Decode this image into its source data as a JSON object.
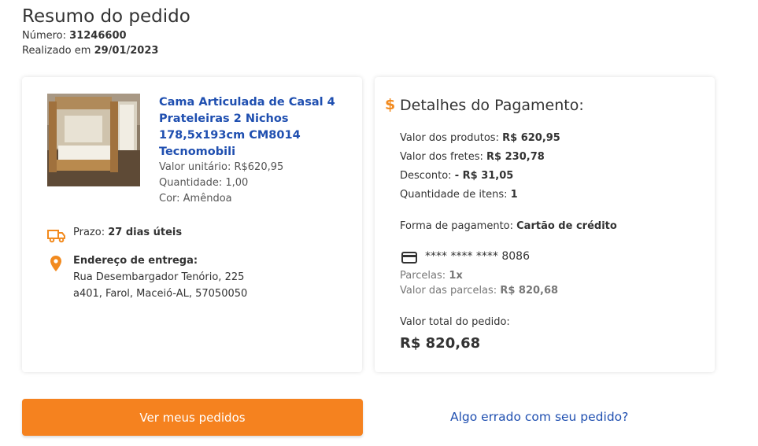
{
  "header": {
    "title": "Resumo do pedido",
    "number_label": "Número:",
    "number_value": "31246600",
    "date_label": "Realizado em",
    "date_value": "29/01/2023"
  },
  "product": {
    "name": "Cama Articulada de Casal 4 Prateleiras 2 Nichos 178,5x193cm CM8014 Tecnomobili",
    "unit_price": "Valor unitário: R$620,95",
    "quantity": "Quantidade: 1,00",
    "color": "Cor: Amêndoa",
    "image_alt": "bed-photo"
  },
  "delivery": {
    "deadline_label": "Prazo:",
    "deadline_value": "27 dias úteis",
    "address_label": "Endereço de entrega:",
    "address_line1": "Rua Desembargador Tenório, 225",
    "address_line2": "a401, Farol, Maceió-AL, 57050050"
  },
  "payment": {
    "title": "Detalhes do Pagamento:",
    "products_label": "Valor dos produtos:",
    "products_value": "R$ 620,95",
    "shipping_label": "Valor dos fretes:",
    "shipping_value": "R$ 230,78",
    "discount_label": "Desconto:",
    "discount_value": "- R$ 31,05",
    "items_label": "Quantidade de itens:",
    "items_value": "1",
    "method_label": "Forma de pagamento:",
    "method_value": "Cartão de crédito",
    "card_number": "**** **** **** 8086",
    "installments_label": "Parcelas:",
    "installments_value": "1x",
    "installment_value_label": "Valor das parcelas:",
    "installment_value": "R$ 820,68",
    "total_label": "Valor total do pedido:",
    "total_value": "R$ 820,68"
  },
  "actions": {
    "orders_button": "Ver meus pedidos",
    "issue_link": "Algo errado com seu pedido?"
  },
  "colors": {
    "accent": "#f5821f",
    "link": "#1f4fb0"
  }
}
